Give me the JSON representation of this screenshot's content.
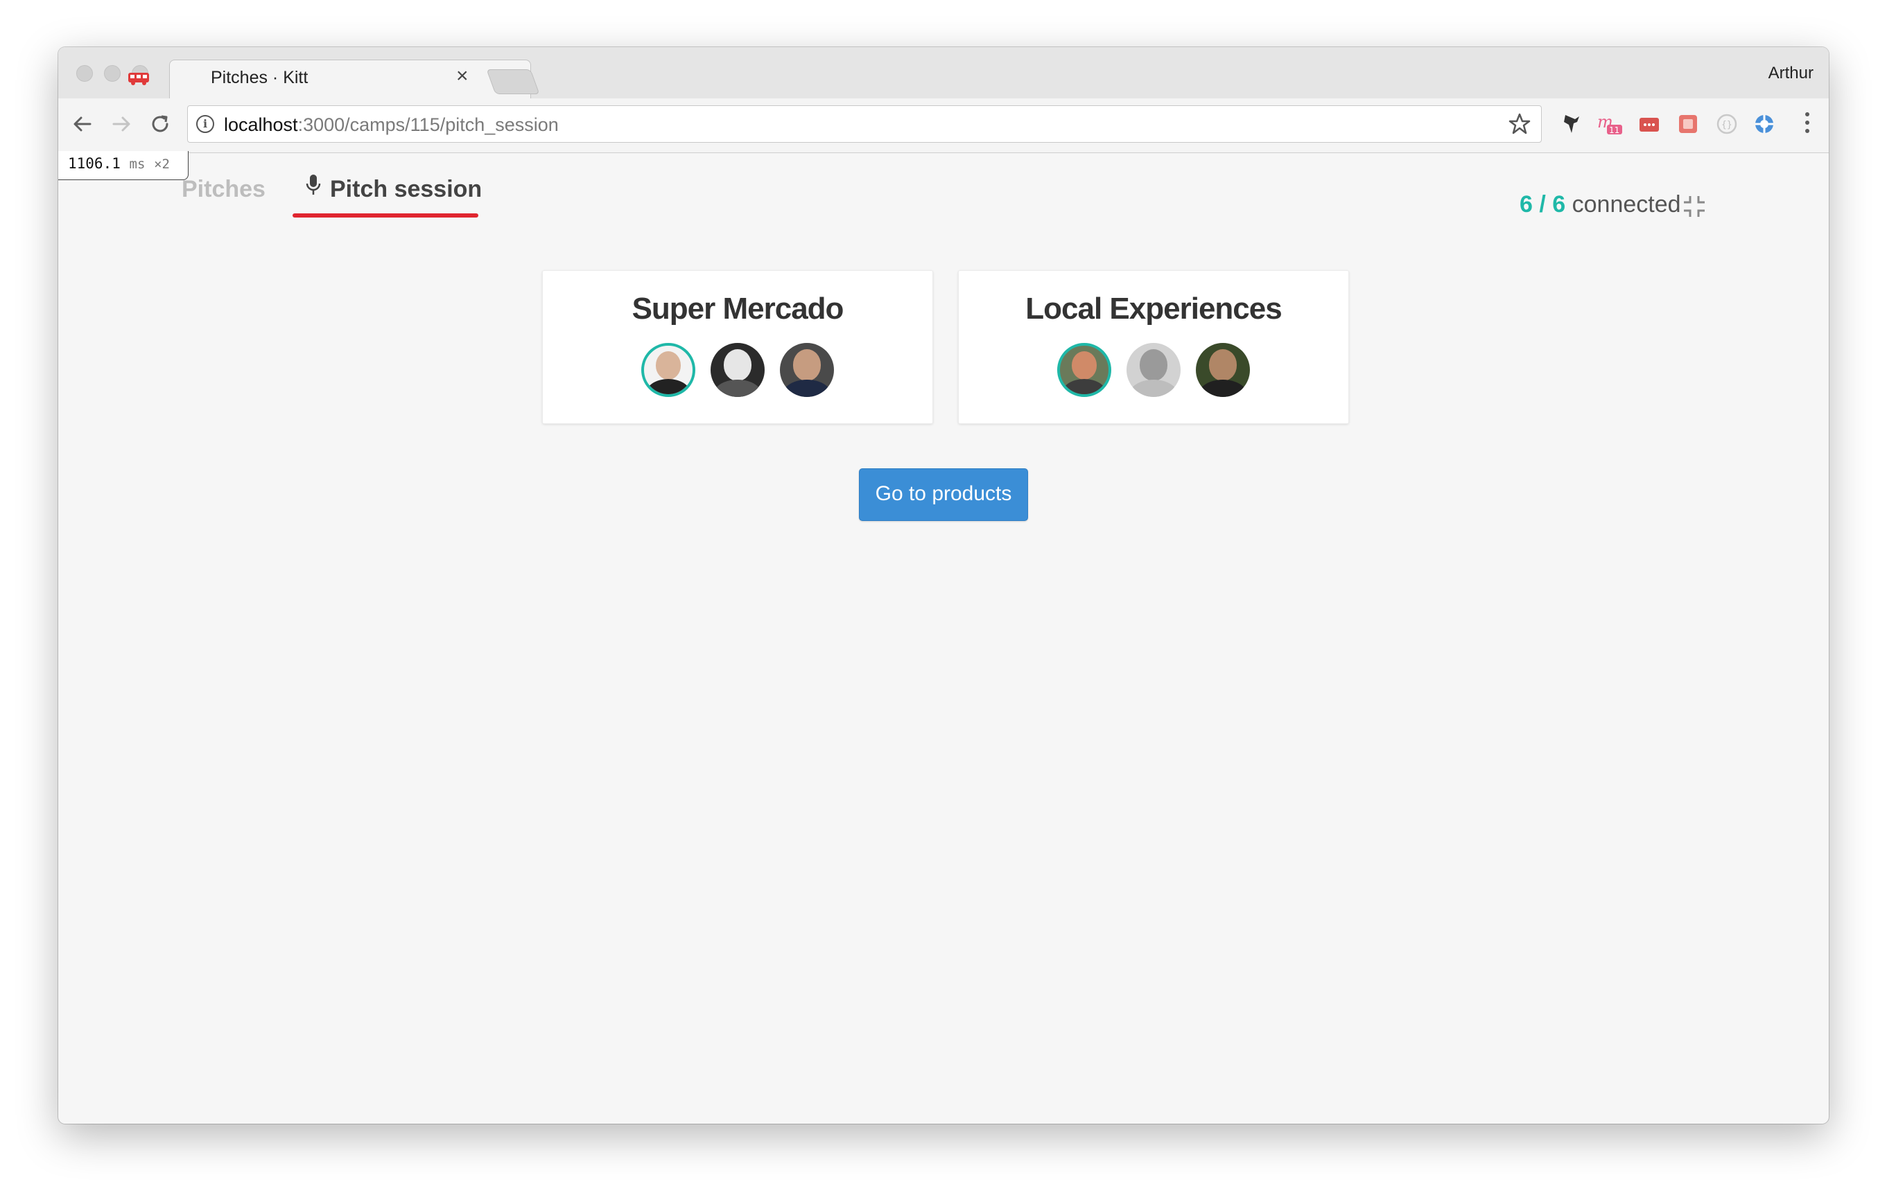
{
  "browser": {
    "tab_title": "Pitches · Kitt",
    "profile_name": "Arthur",
    "url_host": "localhost",
    "url_path": ":3000/camps/115/pitch_session",
    "close_glyph": "×"
  },
  "perf_badge": {
    "value": "1106.1",
    "unit": "ms",
    "multiplier": "×2"
  },
  "nav": {
    "tabs": [
      {
        "label": "Pitches",
        "active": false
      },
      {
        "label": "Pitch session",
        "active": true,
        "icon": "microphone-icon"
      }
    ]
  },
  "status": {
    "count": "6 / 6",
    "label": "connected"
  },
  "teams": [
    {
      "name": "Super Mercado",
      "members": [
        {
          "online": true
        },
        {
          "online": false
        },
        {
          "online": false
        }
      ]
    },
    {
      "name": "Local Experiences",
      "members": [
        {
          "online": true
        },
        {
          "online": false
        },
        {
          "online": false
        }
      ]
    }
  ],
  "actions": {
    "go_to_products": "Go to products"
  },
  "colors": {
    "accent_teal": "#1fb8a8",
    "tab_underline": "#e0252f",
    "button_blue": "#3b8ed6"
  }
}
